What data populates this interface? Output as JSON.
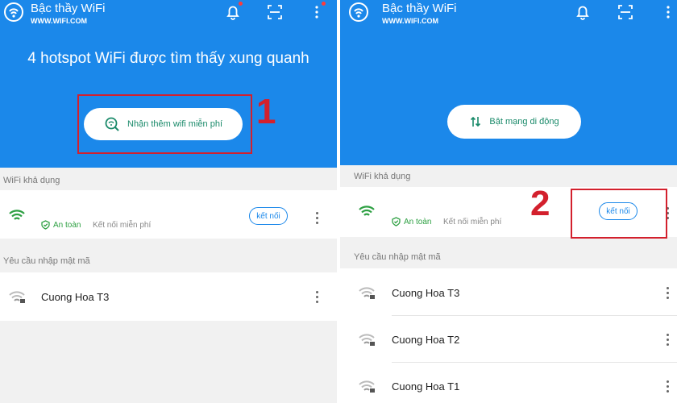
{
  "app": {
    "title": "Bậc thầy WiFi",
    "url": "WWW.WIFI.COM"
  },
  "left": {
    "headline": "4 hotspot WiFi được tìm thấy xung quanh",
    "more_wifi_button": "Nhận thêm wifi miễn phí",
    "step_number": "1",
    "available_label": "WiFi khả dụng",
    "safe_label": "An toàn",
    "free_label": "Kết nối miễn phí",
    "connect_label": "kết nối",
    "password_label": "Yêu cầu nhập mật mã",
    "networks": [
      "Cuong Hoa T3"
    ]
  },
  "right": {
    "mobile_data_button": "Bật mạng di động",
    "step_number": "2",
    "available_label": "WiFi khả dụng",
    "safe_label": "An toàn",
    "free_label": "Kết nối miễn phí",
    "connect_label": "kết nối",
    "password_label": "Yêu cầu nhập mật mã",
    "networks": [
      "Cuong Hoa T3",
      "Cuong Hoa T2",
      "Cuong Hoa T1"
    ]
  },
  "colors": {
    "header_blue": "#1b88ea",
    "accent_green": "#2ea043",
    "annotation_red": "#d3202d"
  },
  "icons": [
    "wifi-logo-icon",
    "bell-icon",
    "scan-icon",
    "more-vertical-icon",
    "search-wifi-icon",
    "shield-check-icon",
    "wifi-signal-icon",
    "wifi-lock-icon",
    "data-toggle-icon"
  ]
}
